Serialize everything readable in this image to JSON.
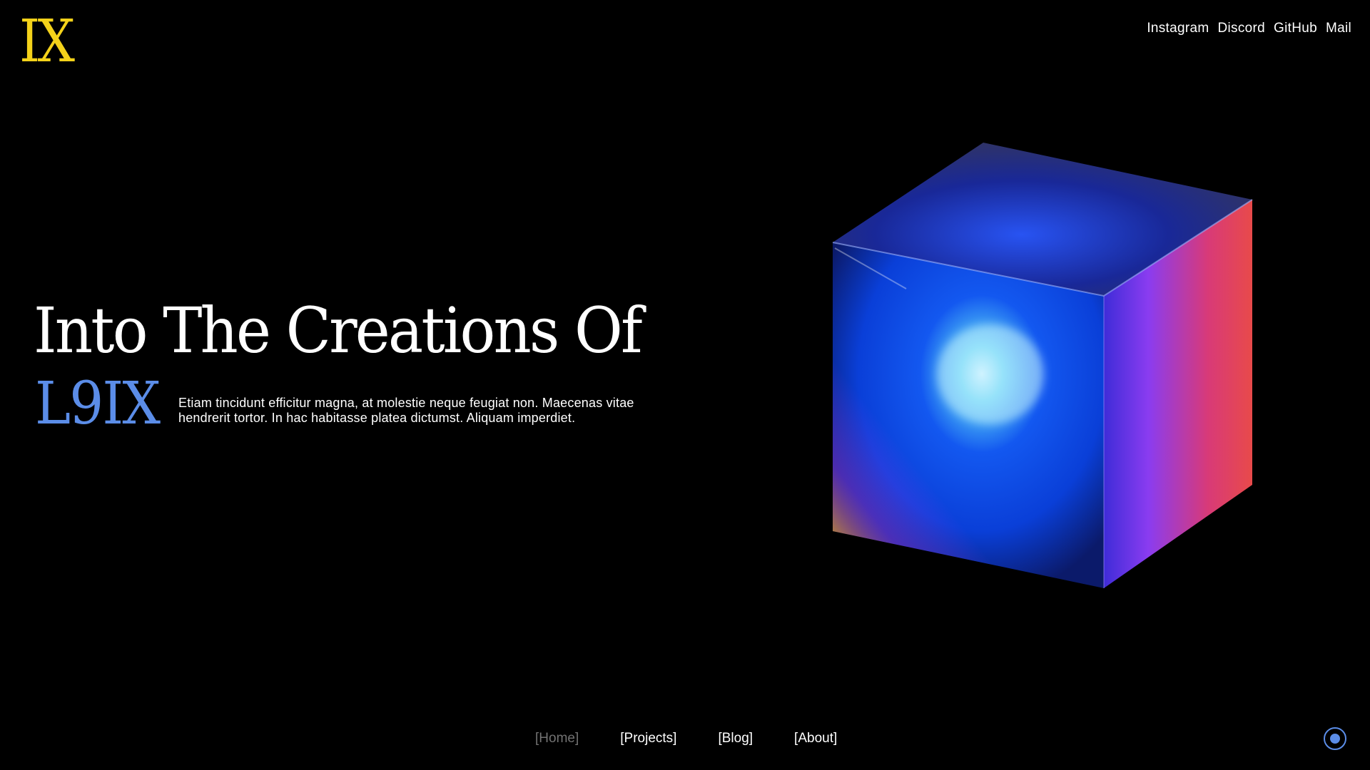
{
  "logo": {
    "text": "IX",
    "color": "#f4d21a"
  },
  "social_links": [
    {
      "label": "Instagram"
    },
    {
      "label": "Discord"
    },
    {
      "label": "GitHub"
    },
    {
      "label": "Mail"
    }
  ],
  "hero": {
    "title": "Into The Creations Of",
    "name": "L9IX",
    "name_color": "#5b8de8",
    "description": "Etiam tincidunt efficitur magna, at molestie neque feugiat non. Maecenas vitae hendrerit tortor. In hac habitasse platea dictumst. Aliquam imperdiet."
  },
  "cube": {
    "icon": "glass-cube-image"
  },
  "bottom_nav": [
    {
      "label": "[Home]",
      "active": true
    },
    {
      "label": "[Projects]",
      "active": false
    },
    {
      "label": "[Blog]",
      "active": false
    },
    {
      "label": "[About]",
      "active": false
    }
  ],
  "indicator": {
    "icon": "circle-dot-icon",
    "color": "#5b8de8"
  }
}
